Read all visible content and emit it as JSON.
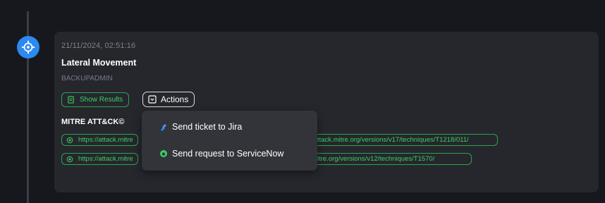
{
  "event": {
    "timestamp": "21/11/2024, 02:51:16",
    "title": "Lateral Movement",
    "user": "BACKUPADMIN"
  },
  "buttons": {
    "show_results": "Show Results",
    "actions": "Actions"
  },
  "mitre": {
    "heading": "MITRE ATT&CK©",
    "links": [
      {
        "prefix": "https://attack.mitre",
        "suffix": "ttack.mitre.org/versions/v17/techniques/T1218/011/"
      },
      {
        "prefix": "https://attack.mitre",
        "suffix": "itre.org/versions/v12/techniques/T1570/"
      }
    ]
  },
  "actions_menu": {
    "items": [
      {
        "label": "Send ticket to Jira",
        "icon": "jira-icon"
      },
      {
        "label": "Send request to ServiceNow",
        "icon": "servicenow-icon"
      }
    ]
  },
  "colors": {
    "background": "#17181d",
    "card": "#25272d",
    "accent_blue": "#2b8af0",
    "accent_green": "#3ccf5f",
    "menu": "#32343a"
  }
}
